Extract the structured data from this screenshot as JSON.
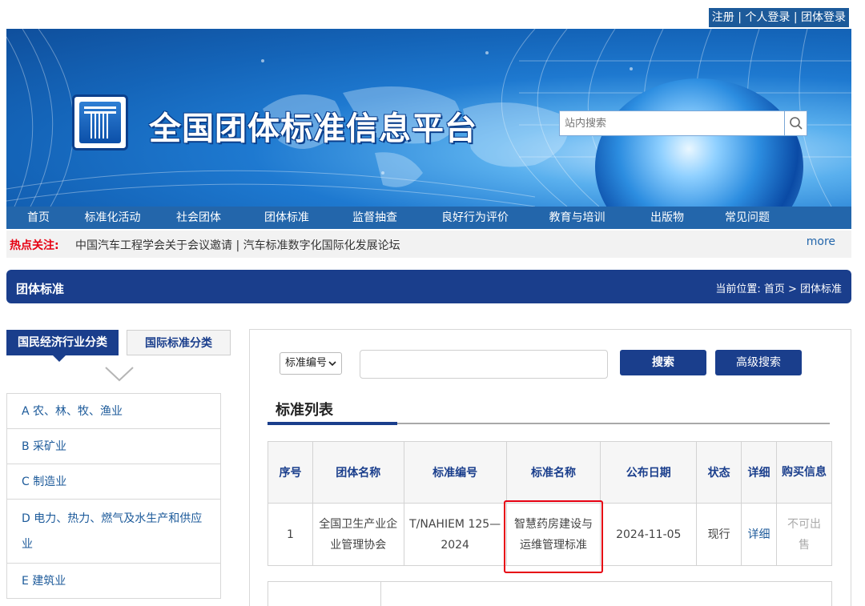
{
  "header": {
    "register": "注册",
    "personal_login": "个人登录",
    "group_login": "团体登录",
    "sep": "|"
  },
  "banner": {
    "site_title": "全国团体标准信息平台",
    "search_placeholder": "站内搜索"
  },
  "nav": {
    "items": [
      "首页",
      "标准化活动",
      "社会团体",
      "团体标准",
      "监督抽查",
      "良好行为评价",
      "教育与培训",
      "出版物",
      "常见问题"
    ]
  },
  "hot": {
    "label": "热点关注:",
    "news": "中国汽车工程学会关于会议邀请 | 汽车标准数字化国际化发展论坛",
    "more": "more"
  },
  "section": {
    "title": "团体标准",
    "breadcrumb": "当前位置: 首页 > 团体标准"
  },
  "sidebar": {
    "tab_active": "国民经济行业分类",
    "tab_inactive": "国际标准分类",
    "categories": [
      "A 农、林、牧、渔业",
      "B 采矿业",
      "C 制造业",
      "D 电力、热力、燃气及水生产和供应业",
      "E 建筑业"
    ]
  },
  "search": {
    "field_select": "标准编号",
    "search_button": "搜索",
    "advanced_button": "高级搜索"
  },
  "list": {
    "title": "标准列表",
    "columns": [
      "序号",
      "团体名称",
      "标准编号",
      "标准名称",
      "公布日期",
      "状态",
      "详细",
      "购买信息"
    ],
    "rows": [
      {
        "index": "1",
        "group": "全国卫生产业企业管理协会",
        "code": "T/NAHIEM 125—2024",
        "name": "智慧药房建设与运维管理标准",
        "date": "2024-11-05",
        "status": "现行",
        "detail": "详细",
        "purchase": "不可出售"
      }
    ]
  },
  "colors": {
    "navy": "#1a3e8c",
    "nav_blue": "#2366ab",
    "link_blue": "#1c5a9a",
    "hot_red": "#e60012",
    "highlight_red": "#e60012"
  }
}
